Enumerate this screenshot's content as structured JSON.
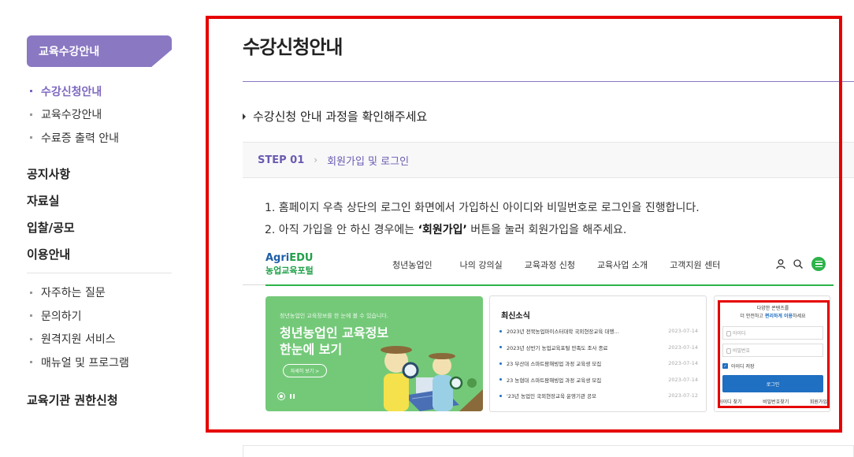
{
  "sidebar": {
    "header": "교육수강안내",
    "sub_items": [
      {
        "label": "수강신청안내",
        "active": true
      },
      {
        "label": "교육수강안내",
        "active": false
      },
      {
        "label": "수료증 출력 안내",
        "active": false
      }
    ],
    "menu": [
      "공지사항",
      "자료실",
      "입찰/공모",
      "이용안내"
    ],
    "sub_items2": [
      "자주하는 질문",
      "문의하기",
      "원격지원 서비스",
      "매뉴얼 및 프로그램"
    ],
    "last": "교육기관 권한신청"
  },
  "main": {
    "title": "수강신청안내",
    "guide": "수강신청 안내 과정을 확인해주세요",
    "step": {
      "number": "STEP 01",
      "text": "회원가입 및 로그인"
    },
    "desc1": "1. 홈페이지 우측 상단의 로그인 화면에서 가입하신 아이디와 비밀번호로 로그인을 진행합니다.",
    "desc2_prefix": "2. 아직 가입을 안 하신 경우에는 ",
    "desc2_bold": "‘회원가입’",
    "desc2_suffix": " 버튼을 눌러 회원가입을 해주세요."
  },
  "portal": {
    "logo_agri": "Agri",
    "logo_edu": "EDU",
    "logo_kr": "농업교육포털",
    "nav": [
      "청년농업인",
      "나의 강의실",
      "교육과정 신청",
      "교육사업 소개",
      "고객지원 센터"
    ],
    "banner": {
      "small": "청년농업인 교육정보를 한 눈에 볼 수 있습니다.",
      "line1": "청년농업인 교육정보",
      "line2": "한눈에 보기",
      "more": "자세히 보기 >"
    },
    "news": {
      "title": "최신소식",
      "items": [
        {
          "text": "2023년 전북농업마이스터대학 국외현장교육 대행…",
          "date": "2023-07-14"
        },
        {
          "text": "2023년 상반기 농업교육포털 만족도 조사 종료",
          "date": "2023-07-14"
        },
        {
          "text": "23 부산대 스마트팜해빙업 과정 교육생 모집",
          "date": "2023-07-14"
        },
        {
          "text": "23 농협대 스마트팜해빙업 과정 교육생 모집",
          "date": "2023-07-14"
        },
        {
          "text": "'23년 농업인 국외현장교육 운영기관 공모",
          "date": "2023-07-12"
        }
      ]
    },
    "login": {
      "msg1": "다양한 콘텐츠를",
      "msg2_prefix": "더 안전하고 ",
      "msg2_bold": "편리하게 이용",
      "msg2_suffix": "하세요",
      "id_placeholder": "아이디",
      "pw_placeholder": "비밀번호",
      "save_id": "아이디 저장",
      "button": "로그인",
      "links": [
        "아이디 찾기",
        "비밀번호찾기",
        "회원가입"
      ]
    }
  },
  "colors": {
    "accent": "#8a78c2",
    "highlight": "#e60000",
    "portal_green": "#2db34a",
    "portal_blue": "#1f6fc2"
  }
}
